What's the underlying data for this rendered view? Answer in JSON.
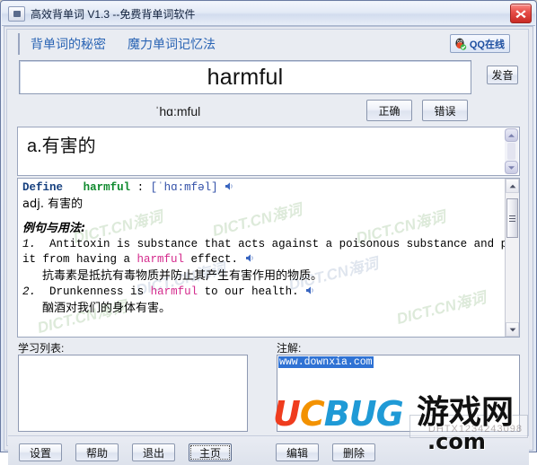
{
  "window": {
    "title": "高效背单词 V1.3  --免费背单词软件",
    "sysicon": "minimize-box-icon",
    "close_label": "×"
  },
  "navbar": {
    "link1": "背单词的秘密",
    "link2": "魔力单词记忆法",
    "qq_label": "QQ在线"
  },
  "word": {
    "text": "harmful",
    "pron_button": "发音",
    "phonetic": "ˈhɑ:mful",
    "correct_button": "正确",
    "wrong_button": "错误"
  },
  "meaning": {
    "text": "a.有害的"
  },
  "dictionary": {
    "define_label": "Define",
    "define_word": "harmful",
    "define_colon": " :",
    "define_ipa": "[ˈhɑ:mfəl]",
    "pos_line": "adj. 有害的",
    "examples_header": "例句与用法:",
    "ex1_num": "1.",
    "ex1_a": "Antitoxin is substance that acts against a poisonous substance and prevents",
    "ex1_b1": "it from having a ",
    "ex1_kw": "harmful",
    "ex1_b2": " effect.",
    "ex1_cn": "抗毒素是抵抗有毒物质并防止其产生有害作用的物质。",
    "ex2_num": "2.",
    "ex2_a": "Drunkenness is ",
    "ex2_kw": "harmful",
    "ex2_b": " to our health.",
    "ex2_cn": "酗酒对我们的身体有害。",
    "watermark_text": "DICT.CN海词",
    "speaker_icon": "speaker-icon"
  },
  "panels": {
    "study_label": "学习列表:",
    "note_label": "注解:",
    "note_value": "www.downxia.com"
  },
  "toolbar": {
    "settings": "设置",
    "help": "帮助",
    "exit": "退出",
    "home": "主页",
    "edit": "编辑",
    "extra": "删除"
  },
  "overlay": {
    "brand_u": "U",
    "brand_c": "C",
    "brand_b": "B",
    "brand_u2": "U",
    "brand_g": "G",
    "brand_cn": "游戏网",
    "brand_domain": ".com",
    "ghost_text": "DHTX1234243098"
  },
  "colors": {
    "accent_link": "#2a64b4",
    "title_text": "#10203c",
    "define_kw": "#16407f",
    "define_word": "#0f8a2e",
    "ipa": "#3250a8",
    "example_kw": "#d42a8c",
    "selection": "#2f72d4",
    "close_red": "#c92a24"
  }
}
